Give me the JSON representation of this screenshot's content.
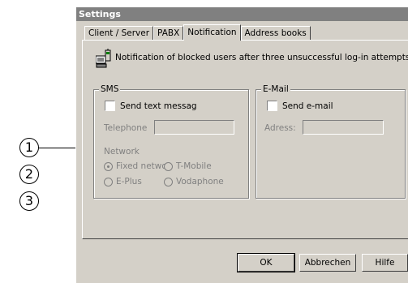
{
  "window": {
    "title": "Settings"
  },
  "tabs": [
    {
      "label": "Client / Server",
      "active": false
    },
    {
      "label": "PABX",
      "active": false
    },
    {
      "label": "Notification",
      "active": true
    },
    {
      "label": "Address books",
      "active": false
    }
  ],
  "info": {
    "text": "Notification of blocked users after three unsuccessful log-in attempts:",
    "icon": "phone-computer-icon"
  },
  "sms": {
    "label": "SMS",
    "checkbox_label": "Send text messag",
    "checked": false,
    "telephone_label": "Telephone",
    "telephone_value": "",
    "network_label": "Network",
    "networks": [
      {
        "label": "Fixed netwo",
        "selected": true
      },
      {
        "label": "T-Mobile",
        "selected": false
      },
      {
        "label": "E-Plus",
        "selected": false
      },
      {
        "label": "Vodaphone",
        "selected": false
      }
    ]
  },
  "email": {
    "label": "E-Mail",
    "checkbox_label": "Send e-mail",
    "checked": false,
    "address_label": "Adress:",
    "address_value": ""
  },
  "buttons": {
    "ok": "OK",
    "cancel": "Abbrechen",
    "help": "Hilfe"
  },
  "callouts": [
    "1",
    "2",
    "3"
  ]
}
